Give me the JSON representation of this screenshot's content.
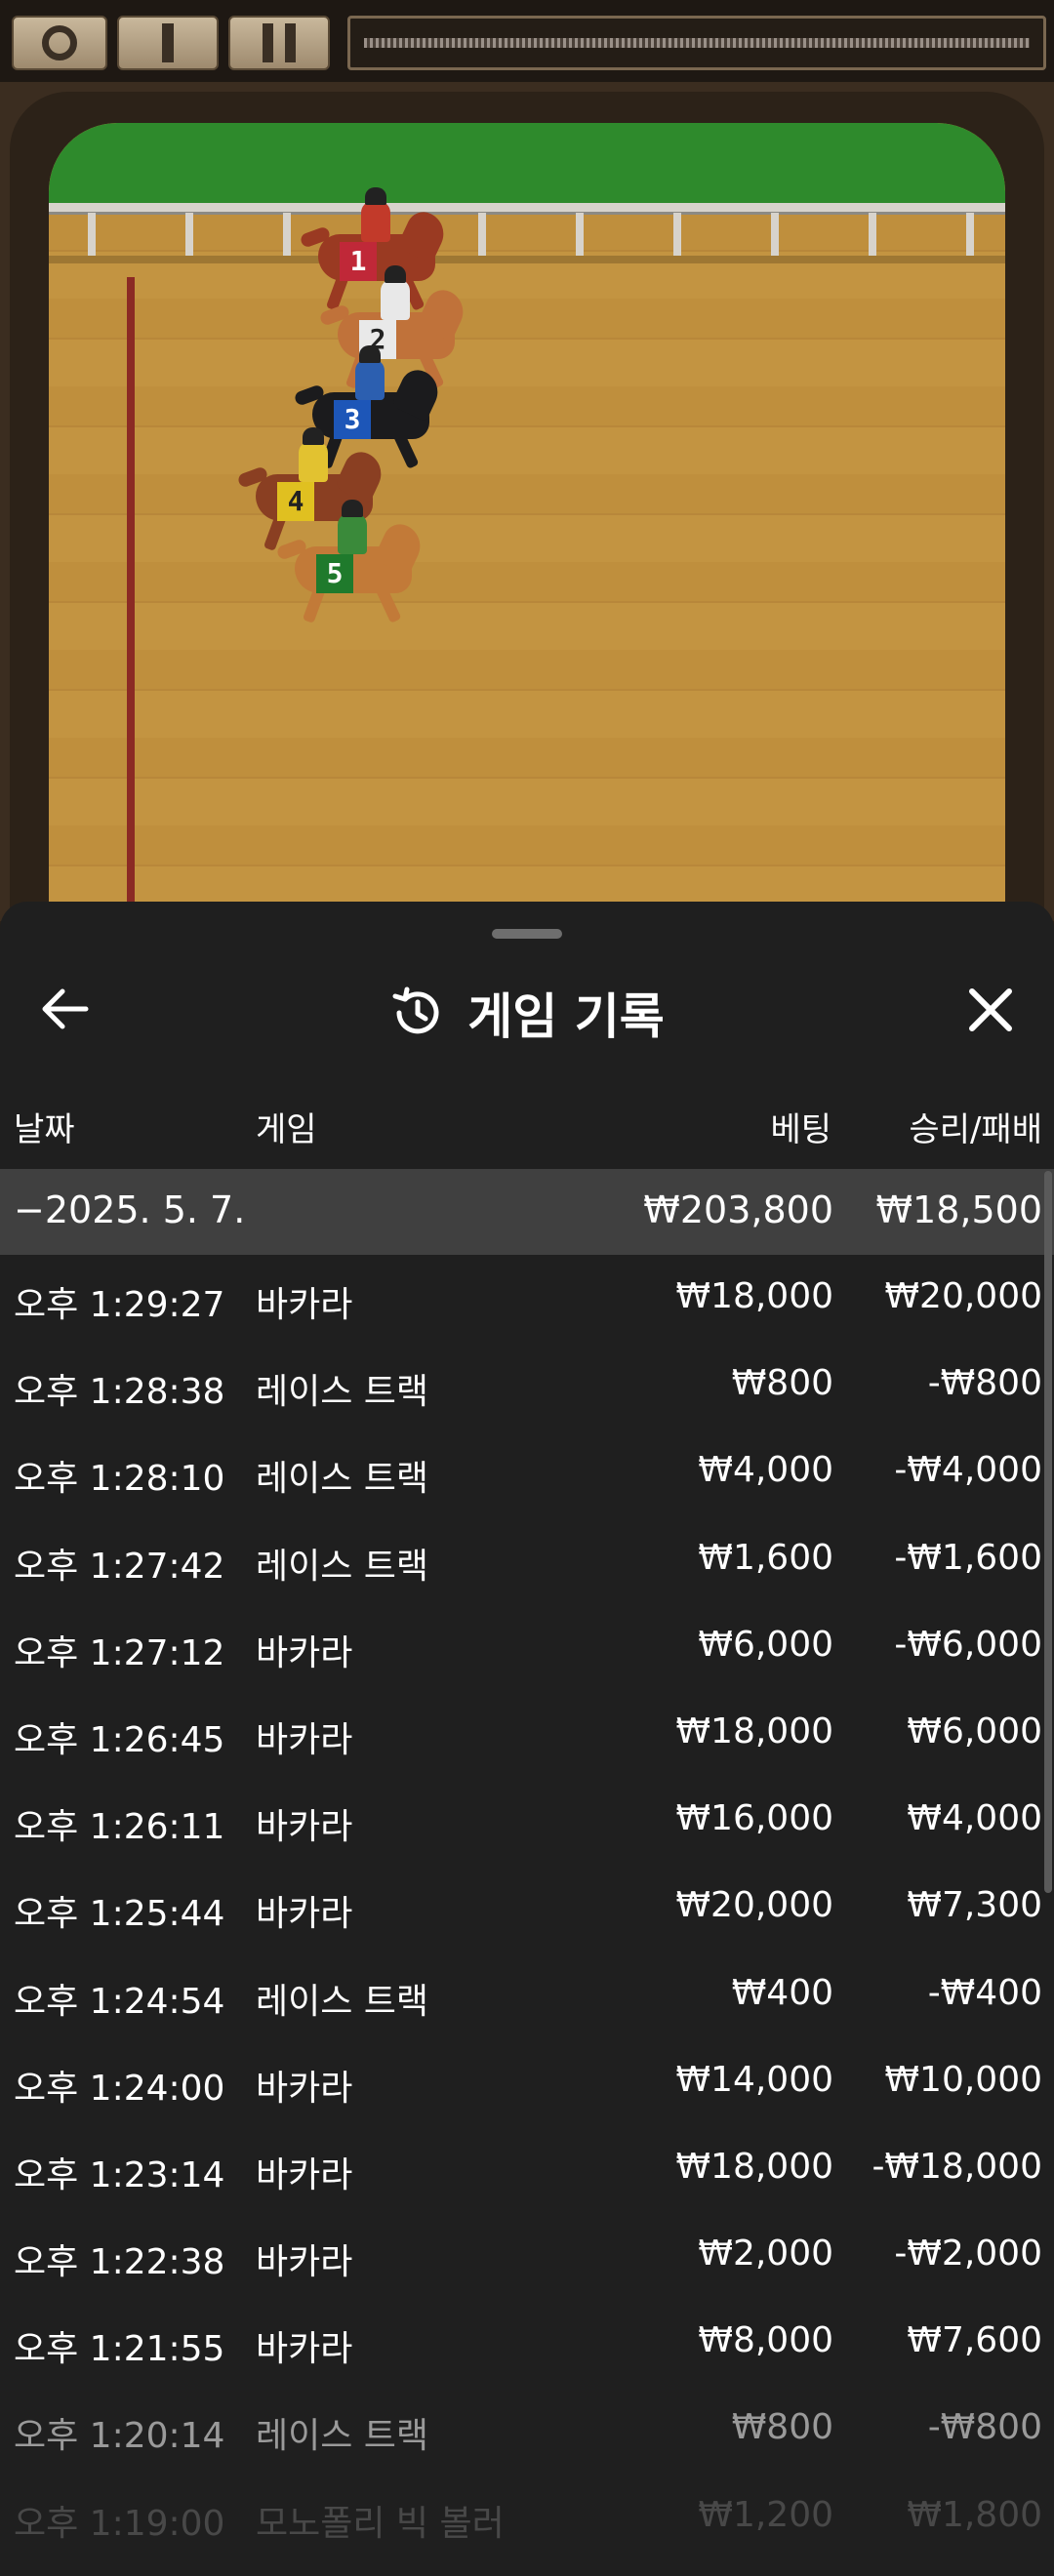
{
  "controls": {
    "record_icon": "circle-icon",
    "play_icon": "bar-icon",
    "pause_icon": "pause-icon"
  },
  "track": {
    "horses": [
      {
        "number": "1",
        "rider_color": "#c23a2a",
        "horse_color": "#9a3a22",
        "bib_color": "#c02838"
      },
      {
        "number": "2",
        "rider_color": "#e8e8e8",
        "horse_color": "#c0723a",
        "bib_color": "#e9e9e9"
      },
      {
        "number": "3",
        "rider_color": "#2c5fb0",
        "horse_color": "#1b1b1d",
        "bib_color": "#1d56b8"
      },
      {
        "number": "4",
        "rider_color": "#e2c230",
        "horse_color": "#8a3f22",
        "bib_color": "#e0c020"
      },
      {
        "number": "5",
        "rider_color": "#3a8a3a",
        "horse_color": "#c27a38",
        "bib_color": "#1f7a2c"
      }
    ]
  },
  "sheet": {
    "title": "게임 기록",
    "title_icon": "history-icon",
    "back_icon": "arrow-left-icon",
    "close_icon": "close-icon",
    "columns": {
      "date": "날짜",
      "game": "게임",
      "bet": "베팅",
      "win": "승리/패배"
    },
    "group": {
      "date": "−2025. 5. 7.",
      "bet": "₩203,800",
      "win": "₩18,500"
    },
    "rows": [
      {
        "time": "오후 1:29:27",
        "game": "바카라",
        "bet": "₩18,000",
        "win": "₩20,000"
      },
      {
        "time": "오후 1:28:38",
        "game": "레이스 트랙",
        "bet": "₩800",
        "win": "-₩800"
      },
      {
        "time": "오후 1:28:10",
        "game": "레이스 트랙",
        "bet": "₩4,000",
        "win": "-₩4,000"
      },
      {
        "time": "오후 1:27:42",
        "game": "레이스 트랙",
        "bet": "₩1,600",
        "win": "-₩1,600"
      },
      {
        "time": "오후 1:27:12",
        "game": "바카라",
        "bet": "₩6,000",
        "win": "-₩6,000"
      },
      {
        "time": "오후 1:26:45",
        "game": "바카라",
        "bet": "₩18,000",
        "win": "₩6,000"
      },
      {
        "time": "오후 1:26:11",
        "game": "바카라",
        "bet": "₩16,000",
        "win": "₩4,000"
      },
      {
        "time": "오후 1:25:44",
        "game": "바카라",
        "bet": "₩20,000",
        "win": "₩7,300"
      },
      {
        "time": "오후 1:24:54",
        "game": "레이스 트랙",
        "bet": "₩400",
        "win": "-₩400"
      },
      {
        "time": "오후 1:24:00",
        "game": "바카라",
        "bet": "₩14,000",
        "win": "₩10,000"
      },
      {
        "time": "오후 1:23:14",
        "game": "바카라",
        "bet": "₩18,000",
        "win": "-₩18,000"
      },
      {
        "time": "오후 1:22:38",
        "game": "바카라",
        "bet": "₩2,000",
        "win": "-₩2,000"
      },
      {
        "time": "오후 1:21:55",
        "game": "바카라",
        "bet": "₩8,000",
        "win": "₩7,600"
      },
      {
        "time": "오후 1:20:14",
        "game": "레이스 트랙",
        "bet": "₩800",
        "win": "-₩800"
      },
      {
        "time": "오후 1:19:00",
        "game": "모노폴리 빅 볼러",
        "bet": "₩1,200",
        "win": "₩1,800"
      }
    ]
  }
}
